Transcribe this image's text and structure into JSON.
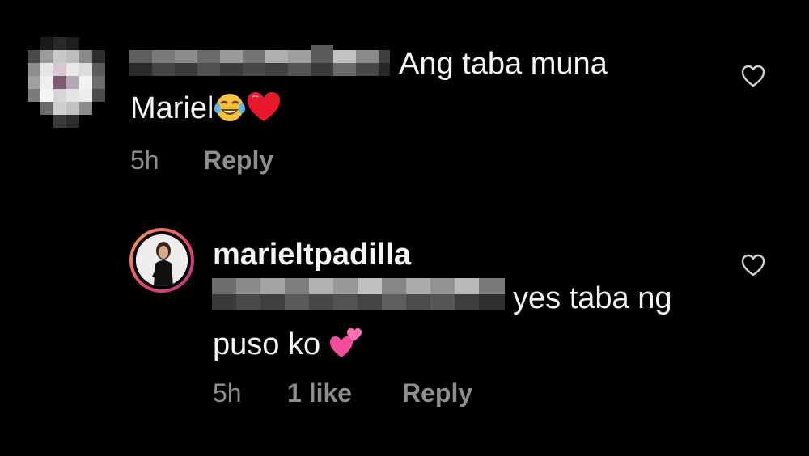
{
  "comments": [
    {
      "text_line1": "Ang taba muna",
      "text_line2": "Mariel",
      "time": "5h",
      "reply_label": "Reply",
      "emojis": [
        "tears-of-joy-emoji",
        "red-heart-emoji"
      ]
    }
  ],
  "reply": {
    "username": "marieltpadilla",
    "text_line1": "yes taba ng",
    "text_line2": "puso ko",
    "time": "5h",
    "likes": "1 like",
    "reply_label": "Reply",
    "emojis": [
      "two-hearts-emoji"
    ]
  },
  "icons": {
    "like": "heart-outline-icon"
  },
  "colors": {
    "background": "#000000",
    "text": "#f5f5f5",
    "meta": "#8e8e8e",
    "story_ring": "#e8456b"
  }
}
